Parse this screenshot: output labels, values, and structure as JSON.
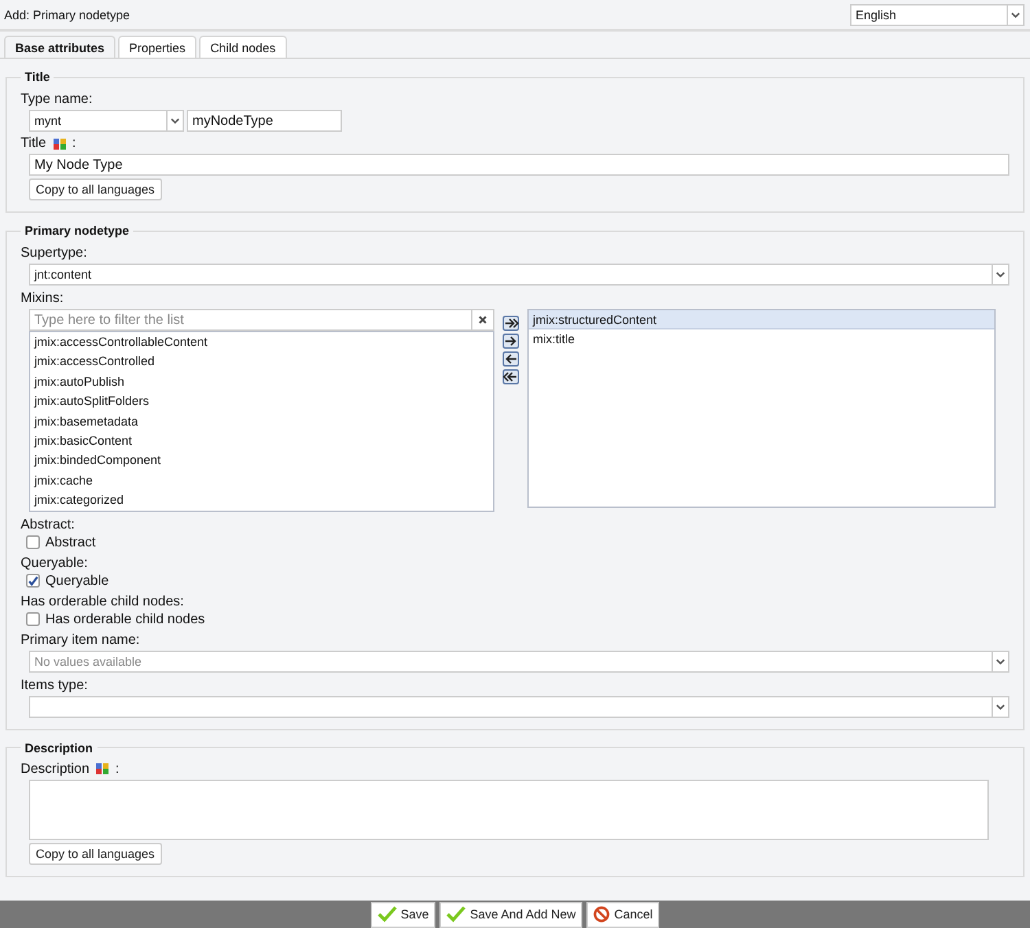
{
  "window": {
    "title": "Add: Primary nodetype"
  },
  "language": {
    "value": "English"
  },
  "tabs": [
    {
      "label": "Base attributes",
      "selected": true
    },
    {
      "label": "Properties",
      "selected": false
    },
    {
      "label": "Child nodes",
      "selected": false
    }
  ],
  "title_section": {
    "legend": "Title",
    "type_name_label": "Type name:",
    "prefix": "mynt",
    "name": "myNodeType",
    "title_label": {
      "text": "Title",
      "suffix": ":"
    },
    "title_value": "My Node Type",
    "copy_button": "Copy to all languages"
  },
  "primary": {
    "legend": "Primary nodetype",
    "supertype_label": "Supertype:",
    "supertype": "jnt:content",
    "mixins_label": "Mixins:",
    "filter_placeholder": "Type here to filter the list",
    "available": [
      "jmix:accessControllableContent",
      "jmix:accessControlled",
      "jmix:autoPublish",
      "jmix:autoSplitFolders",
      "jmix:basemetadata",
      "jmix:basicContent",
      "jmix:bindedComponent",
      "jmix:cache",
      "jmix:categorized"
    ],
    "chosen": [
      {
        "label": "jmix:structuredContent",
        "selected": true
      },
      {
        "label": "mix:title",
        "selected": false
      }
    ],
    "checks": [
      {
        "heading": "Abstract:",
        "label": "Abstract",
        "checked": false
      },
      {
        "heading": "Queryable:",
        "label": "Queryable",
        "checked": true
      },
      {
        "heading": "Has orderable child nodes:",
        "label": "Has orderable child nodes",
        "checked": false
      }
    ],
    "primary_item_label": "Primary item name:",
    "primary_item_placeholder": "No values available",
    "items_type_label": "Items type:"
  },
  "description": {
    "legend": "Description",
    "label": {
      "text": "Description",
      "suffix": ":"
    },
    "copy_button": "Copy to all languages"
  },
  "buttons": [
    {
      "label": "Save",
      "kind": "save"
    },
    {
      "label": "Save And Add New",
      "kind": "save"
    },
    {
      "label": "Cancel",
      "kind": "cancel"
    }
  ]
}
